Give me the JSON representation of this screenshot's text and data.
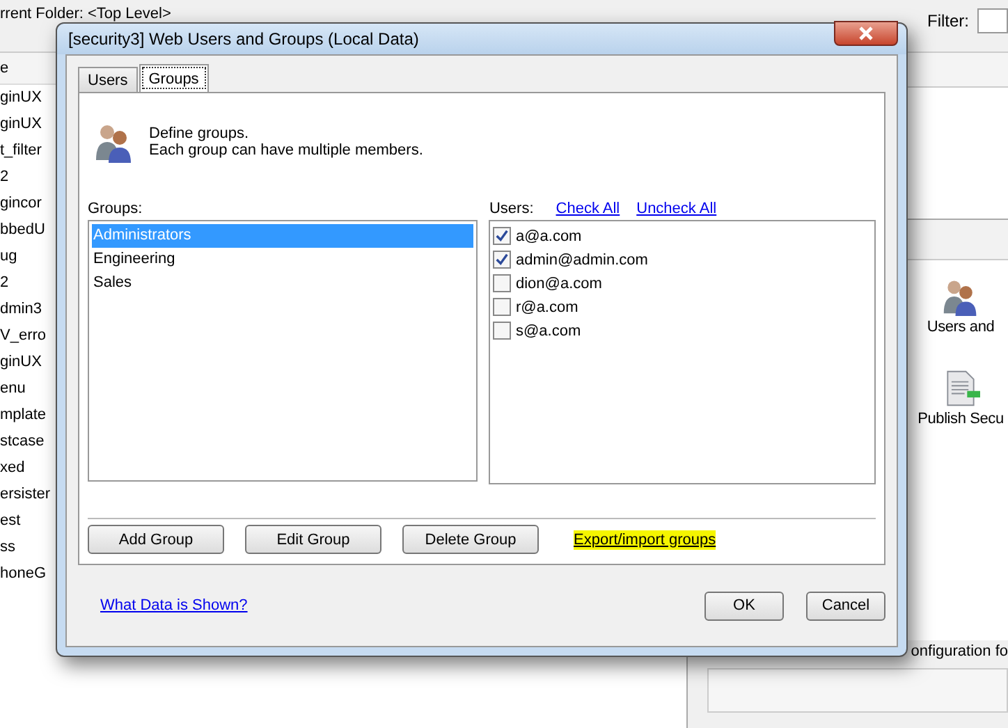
{
  "background": {
    "folder_label": "rrent Folder: <Top Level>",
    "filter_label": "Filter:",
    "list_header": "e",
    "list_items": [
      "ginUX",
      "ginUX",
      "t_filter",
      "2",
      "gincor",
      "bbedU",
      "ug",
      "2",
      "dmin3",
      "V_erro",
      "ginUX",
      "enu",
      "mplate",
      "stcase",
      "xed",
      "ersister",
      "est",
      "ss",
      "honeG"
    ],
    "tools": [
      {
        "kind": "users",
        "label": "Users and"
      },
      {
        "kind": "document",
        "label": "Publish Secu"
      }
    ],
    "description": "onfiguration fo"
  },
  "dialog": {
    "title": "[security3] Web Users and Groups (Local Data)",
    "tabs": [
      {
        "label": "Users",
        "selected": false
      },
      {
        "label": "Groups",
        "selected": true
      }
    ],
    "intro": [
      "Define groups.",
      "Each group can have multiple members."
    ],
    "groups_label": "Groups:",
    "groups": [
      {
        "name": "Administrators",
        "selected": true
      },
      {
        "name": "Engineering",
        "selected": false
      },
      {
        "name": "Sales",
        "selected": false
      }
    ],
    "users_label": "Users:",
    "check_all": "Check All",
    "uncheck_all": "Uncheck All",
    "users": [
      {
        "name": "a@a.com",
        "checked": true
      },
      {
        "name": "admin@admin.com",
        "checked": true
      },
      {
        "name": "dion@a.com",
        "checked": false
      },
      {
        "name": "r@a.com",
        "checked": false
      },
      {
        "name": "s@a.com",
        "checked": false
      }
    ],
    "buttons": [
      "Add Group",
      "Edit Group",
      "Delete Group"
    ],
    "export_link": {
      "label": "Export/import groups",
      "highlighted": true
    },
    "help_link": "What Data is Shown?",
    "footer_buttons": [
      "OK",
      "Cancel"
    ]
  }
}
